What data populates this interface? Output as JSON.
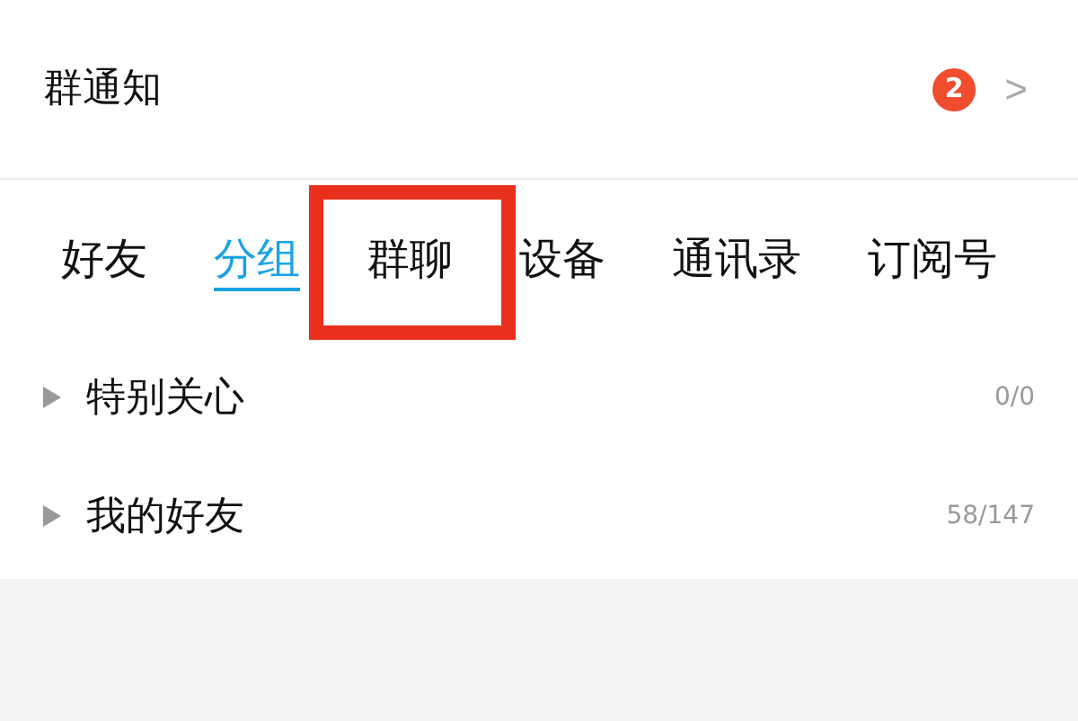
{
  "notice": {
    "title": "群通知",
    "badge": "2",
    "chevron": ">"
  },
  "tabs": [
    {
      "label": "好友",
      "selected": false
    },
    {
      "label": "分组",
      "selected": true
    },
    {
      "label": "群聊",
      "selected": false
    },
    {
      "label": "设备",
      "selected": false
    },
    {
      "label": "通讯录",
      "selected": false
    },
    {
      "label": "订阅号",
      "selected": false
    }
  ],
  "groups": [
    {
      "name": "特别关心",
      "count": "0/0",
      "expanded": false
    },
    {
      "name": "我的好友",
      "count": "58/147",
      "expanded": false
    }
  ]
}
